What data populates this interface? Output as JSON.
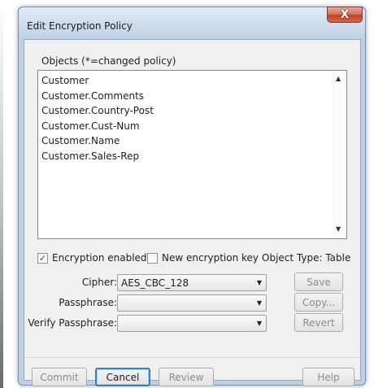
{
  "window": {
    "title": "Edit Encryption Policy",
    "close_glyph": "X"
  },
  "objects": {
    "label": "Objects (*=changed policy)",
    "items": [
      "Customer",
      "Customer.Comments",
      "Customer.Country-Post",
      "Customer.Cust-Num",
      "Customer.Name",
      "Customer.Sales-Rep"
    ]
  },
  "options": {
    "encryption_enabled": {
      "label": "Encryption enabled",
      "checked": true
    },
    "new_encryption_key": {
      "label": "New encryption key",
      "checked": false
    },
    "object_type": "Object Type: Table"
  },
  "form": {
    "cipher_label": "Cipher:",
    "cipher_value": "AES_CBC_128",
    "passphrase_label": "Passphrase:",
    "passphrase_value": "",
    "verify_label": "Verify Passphrase:",
    "verify_value": ""
  },
  "side_buttons": {
    "save": "Save",
    "copy": "Copy...",
    "revert": "Revert"
  },
  "footer_buttons": {
    "commit": "Commit",
    "cancel": "Cancel",
    "review": "Review",
    "help": "Help"
  },
  "icons": {
    "check": "checkmark-icon",
    "dropdown": "chevron-down-icon",
    "scroll_up": "scroll-up-icon",
    "scroll_down": "scroll-down-icon"
  },
  "colors": {
    "title_bar": "#c3d3e8",
    "close_button": "#c0432b",
    "dialog_bg": "#f0f0f0",
    "focus_border": "#3c7fb1"
  }
}
